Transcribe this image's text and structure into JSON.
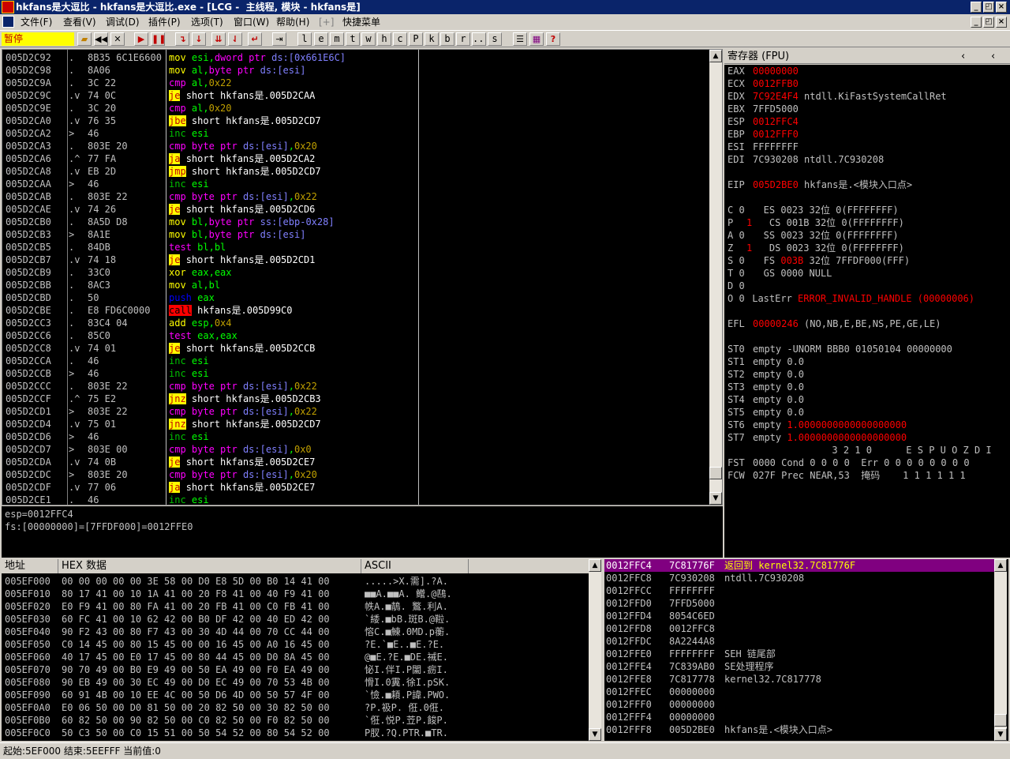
{
  "window": {
    "title": "hkfans是大逗比 - hkfans是大逗比.exe - [LCG -  主线程, 模块 - hkfans是]",
    "minimize": "_",
    "restore": "◰",
    "close": "×"
  },
  "menu": [
    "文件(F)",
    "查看(V)",
    "调试(D)",
    "插件(P)",
    "选项(T)",
    "窗口(W)",
    "帮助(H)",
    "[+]",
    "快捷菜单"
  ],
  "toolbar": {
    "status": "暂停",
    "letter_buttons": [
      "l",
      "e",
      "m",
      "t",
      "w",
      "h",
      "c",
      "P",
      "k",
      "b",
      "r",
      "...",
      "s"
    ]
  },
  "cpu": {
    "rows": [
      {
        "addr": "005D2C92",
        "mark": ".",
        "hex": "8B35 6C1E6600",
        "dis": "mov esi,dword ptr ds:[0x661E6C]"
      },
      {
        "addr": "005D2C98",
        "mark": ".",
        "hex": "8A06",
        "dis": "mov al,byte ptr ds:[esi]"
      },
      {
        "addr": "005D2C9A",
        "mark": ".",
        "hex": "3C 22",
        "dis": "cmp al,0x22"
      },
      {
        "addr": "005D2C9C",
        "mark": ".v",
        "hex": "74 0C",
        "dis": "je short hkfans是.005D2CAA"
      },
      {
        "addr": "005D2C9E",
        "mark": ".",
        "hex": "3C 20",
        "dis": "cmp al,0x20"
      },
      {
        "addr": "005D2CA0",
        "mark": ".v",
        "hex": "76 35",
        "dis": "jbe short hkfans是.005D2CD7"
      },
      {
        "addr": "005D2CA2",
        "mark": ">",
        "hex": "46",
        "dis": "inc esi"
      },
      {
        "addr": "005D2CA3",
        "mark": ".",
        "hex": "803E 20",
        "dis": "cmp byte ptr ds:[esi],0x20"
      },
      {
        "addr": "005D2CA6",
        "mark": ".^",
        "hex": "77 FA",
        "dis": "ja short hkfans是.005D2CA2"
      },
      {
        "addr": "005D2CA8",
        "mark": ".v",
        "hex": "EB 2D",
        "dis": "jmp short hkfans是.005D2CD7"
      },
      {
        "addr": "005D2CAA",
        "mark": ">",
        "hex": "46",
        "dis": "inc esi"
      },
      {
        "addr": "005D2CAB",
        "mark": ".",
        "hex": "803E 22",
        "dis": "cmp byte ptr ds:[esi],0x22"
      },
      {
        "addr": "005D2CAE",
        "mark": ".v",
        "hex": "74 26",
        "dis": "je short hkfans是.005D2CD6"
      },
      {
        "addr": "005D2CB0",
        "mark": ".",
        "hex": "8A5D D8",
        "dis": "mov bl,byte ptr ss:[ebp-0x28]"
      },
      {
        "addr": "005D2CB3",
        "mark": ">",
        "hex": "8A1E",
        "dis": "mov bl,byte ptr ds:[esi]"
      },
      {
        "addr": "005D2CB5",
        "mark": ".",
        "hex": "84DB",
        "dis": "test bl,bl"
      },
      {
        "addr": "005D2CB7",
        "mark": ".v",
        "hex": "74 18",
        "dis": "je short hkfans是.005D2CD1"
      },
      {
        "addr": "005D2CB9",
        "mark": ".",
        "hex": "33C0",
        "dis": "xor eax,eax"
      },
      {
        "addr": "005D2CBB",
        "mark": ".",
        "hex": "8AC3",
        "dis": "mov al,bl"
      },
      {
        "addr": "005D2CBD",
        "mark": ".",
        "hex": "50",
        "dis": "push eax"
      },
      {
        "addr": "005D2CBE",
        "mark": ".",
        "hex": "E8 FD6C0000",
        "dis": "call hkfans是.005D99C0"
      },
      {
        "addr": "005D2CC3",
        "mark": ".",
        "hex": "83C4 04",
        "dis": "add esp,0x4"
      },
      {
        "addr": "005D2CC6",
        "mark": ".",
        "hex": "85C0",
        "dis": "test eax,eax"
      },
      {
        "addr": "005D2CC8",
        "mark": ".v",
        "hex": "74 01",
        "dis": "je short hkfans是.005D2CCB"
      },
      {
        "addr": "005D2CCA",
        "mark": ".",
        "hex": "46",
        "dis": "inc esi"
      },
      {
        "addr": "005D2CCB",
        "mark": ">",
        "hex": "46",
        "dis": "inc esi"
      },
      {
        "addr": "005D2CCC",
        "mark": ".",
        "hex": "803E 22",
        "dis": "cmp byte ptr ds:[esi],0x22"
      },
      {
        "addr": "005D2CCF",
        "mark": ".^",
        "hex": "75 E2",
        "dis": "jnz short hkfans是.005D2CB3"
      },
      {
        "addr": "005D2CD1",
        "mark": ">",
        "hex": "803E 22",
        "dis": "cmp byte ptr ds:[esi],0x22"
      },
      {
        "addr": "005D2CD4",
        "mark": ".v",
        "hex": "75 01",
        "dis": "jnz short hkfans是.005D2CD7"
      },
      {
        "addr": "005D2CD6",
        "mark": ">",
        "hex": "46",
        "dis": "inc esi"
      },
      {
        "addr": "005D2CD7",
        "mark": ">",
        "hex": "803E 00",
        "dis": "cmp byte ptr ds:[esi],0x0"
      },
      {
        "addr": "005D2CDA",
        "mark": ".v",
        "hex": "74 0B",
        "dis": "je short hkfans是.005D2CE7"
      },
      {
        "addr": "005D2CDC",
        "mark": ">",
        "hex": "803E 20",
        "dis": "cmp byte ptr ds:[esi],0x20"
      },
      {
        "addr": "005D2CDF",
        "mark": ".v",
        "hex": "77 06",
        "dis": "ja short hkfans是.005D2CE7"
      },
      {
        "addr": "005D2CE1",
        "mark": ".",
        "hex": "46",
        "dis": "inc esi"
      }
    ]
  },
  "info": [
    "esp=0012FFC4",
    "fs:[00000000]=[7FFDF000]=0012FFE0"
  ],
  "registers": {
    "header": "寄存器 (FPU)",
    "lines": [
      {
        "t": "EAX",
        "v": "00000000",
        "c": "red",
        "x": ""
      },
      {
        "t": "ECX",
        "v": "0012FFB0",
        "c": "red",
        "x": ""
      },
      {
        "t": "EDX",
        "v": "7C92E4F4",
        "c": "red",
        "x": "ntdll.KiFastSystemCallRet"
      },
      {
        "t": "EBX",
        "v": "7FFD5000",
        "c": "",
        "x": ""
      },
      {
        "t": "ESP",
        "v": "0012FFC4",
        "c": "red",
        "x": ""
      },
      {
        "t": "EBP",
        "v": "0012FFF0",
        "c": "red",
        "x": ""
      },
      {
        "t": "ESI",
        "v": "FFFFFFFF",
        "c": "",
        "x": ""
      },
      {
        "t": "EDI",
        "v": "7C930208",
        "c": "",
        "x": "ntdll.7C930208"
      },
      {
        "t": "",
        "v": "",
        "c": "",
        "x": ""
      },
      {
        "t": "EIP",
        "v": "005D2BE0",
        "c": "red",
        "x": "hkfans是.<模块入口点>"
      },
      {
        "t": "",
        "v": "",
        "c": "",
        "x": ""
      },
      {
        "t": "C 0",
        "v": "",
        "c": "",
        "x": "ES 0023 32位 0(FFFFFFFF)"
      },
      {
        "t": "P",
        "v": "1",
        "c": "red",
        "x": "CS 001B 32位 0(FFFFFFFF)"
      },
      {
        "t": "A 0",
        "v": "",
        "c": "",
        "x": "SS 0023 32位 0(FFFFFFFF)"
      },
      {
        "t": "Z",
        "v": "1",
        "c": "red",
        "x": "DS 0023 32位 0(FFFFFFFF)"
      },
      {
        "t": "S 0",
        "v": "",
        "c": "",
        "x": "FS 003B 32位 7FFDF000(FFF)"
      },
      {
        "t": "T 0",
        "v": "",
        "c": "",
        "x": "GS 0000 NULL"
      },
      {
        "t": "D 0",
        "v": "",
        "c": "",
        "x": ""
      },
      {
        "t": "O 0",
        "v": "",
        "c": "",
        "x": "LastErr ERROR_INVALID_HANDLE (00000006)"
      },
      {
        "t": "",
        "v": "",
        "c": "",
        "x": ""
      },
      {
        "t": "EFL",
        "v": "00000246",
        "c": "red",
        "x": "(NO,NB,E,BE,NS,PE,GE,LE)"
      },
      {
        "t": "",
        "v": "",
        "c": "",
        "x": ""
      },
      {
        "t": "ST0",
        "v": "empty",
        "c": "",
        "x": "-UNORM BBB0 01050104 00000000"
      },
      {
        "t": "ST1",
        "v": "empty",
        "c": "",
        "x": "0.0"
      },
      {
        "t": "ST2",
        "v": "empty",
        "c": "",
        "x": "0.0"
      },
      {
        "t": "ST3",
        "v": "empty",
        "c": "",
        "x": "0.0"
      },
      {
        "t": "ST4",
        "v": "empty",
        "c": "",
        "x": "0.0"
      },
      {
        "t": "ST5",
        "v": "empty",
        "c": "",
        "x": "0.0"
      },
      {
        "t": "ST6",
        "v": "empty",
        "c": "",
        "x": "1.0000000000000000000"
      },
      {
        "t": "ST7",
        "v": "empty",
        "c": "",
        "x": "1.0000000000000000000"
      },
      {
        "t": "",
        "v": "",
        "c": "",
        "x": "              3 2 1 0      E S P U O Z D I"
      },
      {
        "t": "FST",
        "v": "0000",
        "c": "",
        "x": "Cond 0 0 0 0  Err 0 0 0 0 0 0 0 0"
      },
      {
        "t": "FCW",
        "v": "027F",
        "c": "",
        "x": "Prec NEAR,53  掩码    1 1 1 1 1 1"
      }
    ]
  },
  "dump": {
    "headers": [
      "地址",
      "HEX 数据",
      "ASCII"
    ],
    "rows": [
      {
        "a": "005EF000",
        "h": "00 00 00 00 00 3E 58 00 D0 E8 5D 00 B0 14 41 00",
        "s": ".....>X.需].?A."
      },
      {
        "a": "005EF010",
        "h": "80 17 41 00 10 1A 41 00 20 F8 41 00 40 F9 41 00",
        "s": "■■A.■■A. 鳤.@鴄."
      },
      {
        "a": "005EF020",
        "h": "E0 F9 41 00 80 FA 41 00 20 FB 41 00 C0 FB 41 00",
        "s": "帙A.■鶄. 鸄.利A."
      },
      {
        "a": "005EF030",
        "h": "60 FC 41 00 10 62 42 00 B0 DF 42 00 40 ED 42 00",
        "s": "`緌.■bB.斑B.@鞡."
      },
      {
        "a": "005EF040",
        "h": "90 F2 43 00 80 F7 43 00 30 4D 44 00 70 CC 44 00",
        "s": "愹C.■鯟.0MD.p蘅."
      },
      {
        "a": "005EF050",
        "h": "C0 14 45 00 80 15 45 00 00 16 45 00 A0 16 45 00",
        "s": "?E.`■E..■E.?E."
      },
      {
        "a": "005EF060",
        "h": "40 17 45 00 E0 17 45 00 80 44 45 00 D0 8A 45 00",
        "s": "@■E.?E.■DE.祴E."
      },
      {
        "a": "005EF070",
        "h": "90 70 49 00 B0 E9 49 00 50 EA 49 00 F0 EA 49 00",
        "s": "怭I.伴I.P闔.疬I."
      },
      {
        "a": "005EF080",
        "h": "90 EB 49 00 30 EC 49 00 D0 EC 49 00 70 53 4B 00",
        "s": "愲I.0霬.徐I.pSK."
      },
      {
        "a": "005EF090",
        "h": "60 91 4B 00 10 EE 4C 00 50 D6 4D 00 50 57 4F 00",
        "s": "`憸.■頛.P諱.PWO."
      },
      {
        "a": "005EF0A0",
        "h": "E0 06 50 00 D0 81 50 00 20 82 50 00 30 82 50 00",
        "s": "?P.衱P. 俇.0俇."
      },
      {
        "a": "005EF0B0",
        "h": "60 82 50 00 90 82 50 00 C0 82 50 00 F0 82 50 00",
        "s": "`俇.悦P.苙P.餕P."
      },
      {
        "a": "005EF0C0",
        "h": "50 C3 50 00 C0 15 51 00 50 54 52 00 80 54 52 00",
        "s": "P肞.?Q.PTR.■TR."
      }
    ]
  },
  "stack": {
    "rows": [
      {
        "a": "0012FFC4",
        "v": "7C81776F",
        "c": "返回到 kernel32.7C81776F",
        "sel": true
      },
      {
        "a": "0012FFC8",
        "v": "7C930208",
        "c": "ntdll.7C930208",
        "sel": false
      },
      {
        "a": "0012FFCC",
        "v": "FFFFFFFF",
        "c": "",
        "sel": false
      },
      {
        "a": "0012FFD0",
        "v": "7FFD5000",
        "c": "",
        "sel": false
      },
      {
        "a": "0012FFD4",
        "v": "8054C6ED",
        "c": "",
        "sel": false
      },
      {
        "a": "0012FFD8",
        "v": "0012FFC8",
        "c": "",
        "sel": false
      },
      {
        "a": "0012FFDC",
        "v": "8A2244A8",
        "c": "",
        "sel": false
      },
      {
        "a": "0012FFE0",
        "v": "FFFFFFFF",
        "c": "SEH 链尾部",
        "sel": false
      },
      {
        "a": "0012FFE4",
        "v": "7C839AB0",
        "c": "SE处理程序",
        "sel": false
      },
      {
        "a": "0012FFE8",
        "v": "7C817778",
        "c": "kernel32.7C817778",
        "sel": false
      },
      {
        "a": "0012FFEC",
        "v": "00000000",
        "c": "",
        "sel": false
      },
      {
        "a": "0012FFF0",
        "v": "00000000",
        "c": "",
        "sel": false
      },
      {
        "a": "0012FFF4",
        "v": "00000000",
        "c": "",
        "sel": false
      },
      {
        "a": "0012FFF8",
        "v": "005D2BE0",
        "c": "hkfans是.<模块入口点>",
        "sel": false
      }
    ]
  },
  "status": "起始:5EF000 结束:5EEFFF 当前值:0"
}
